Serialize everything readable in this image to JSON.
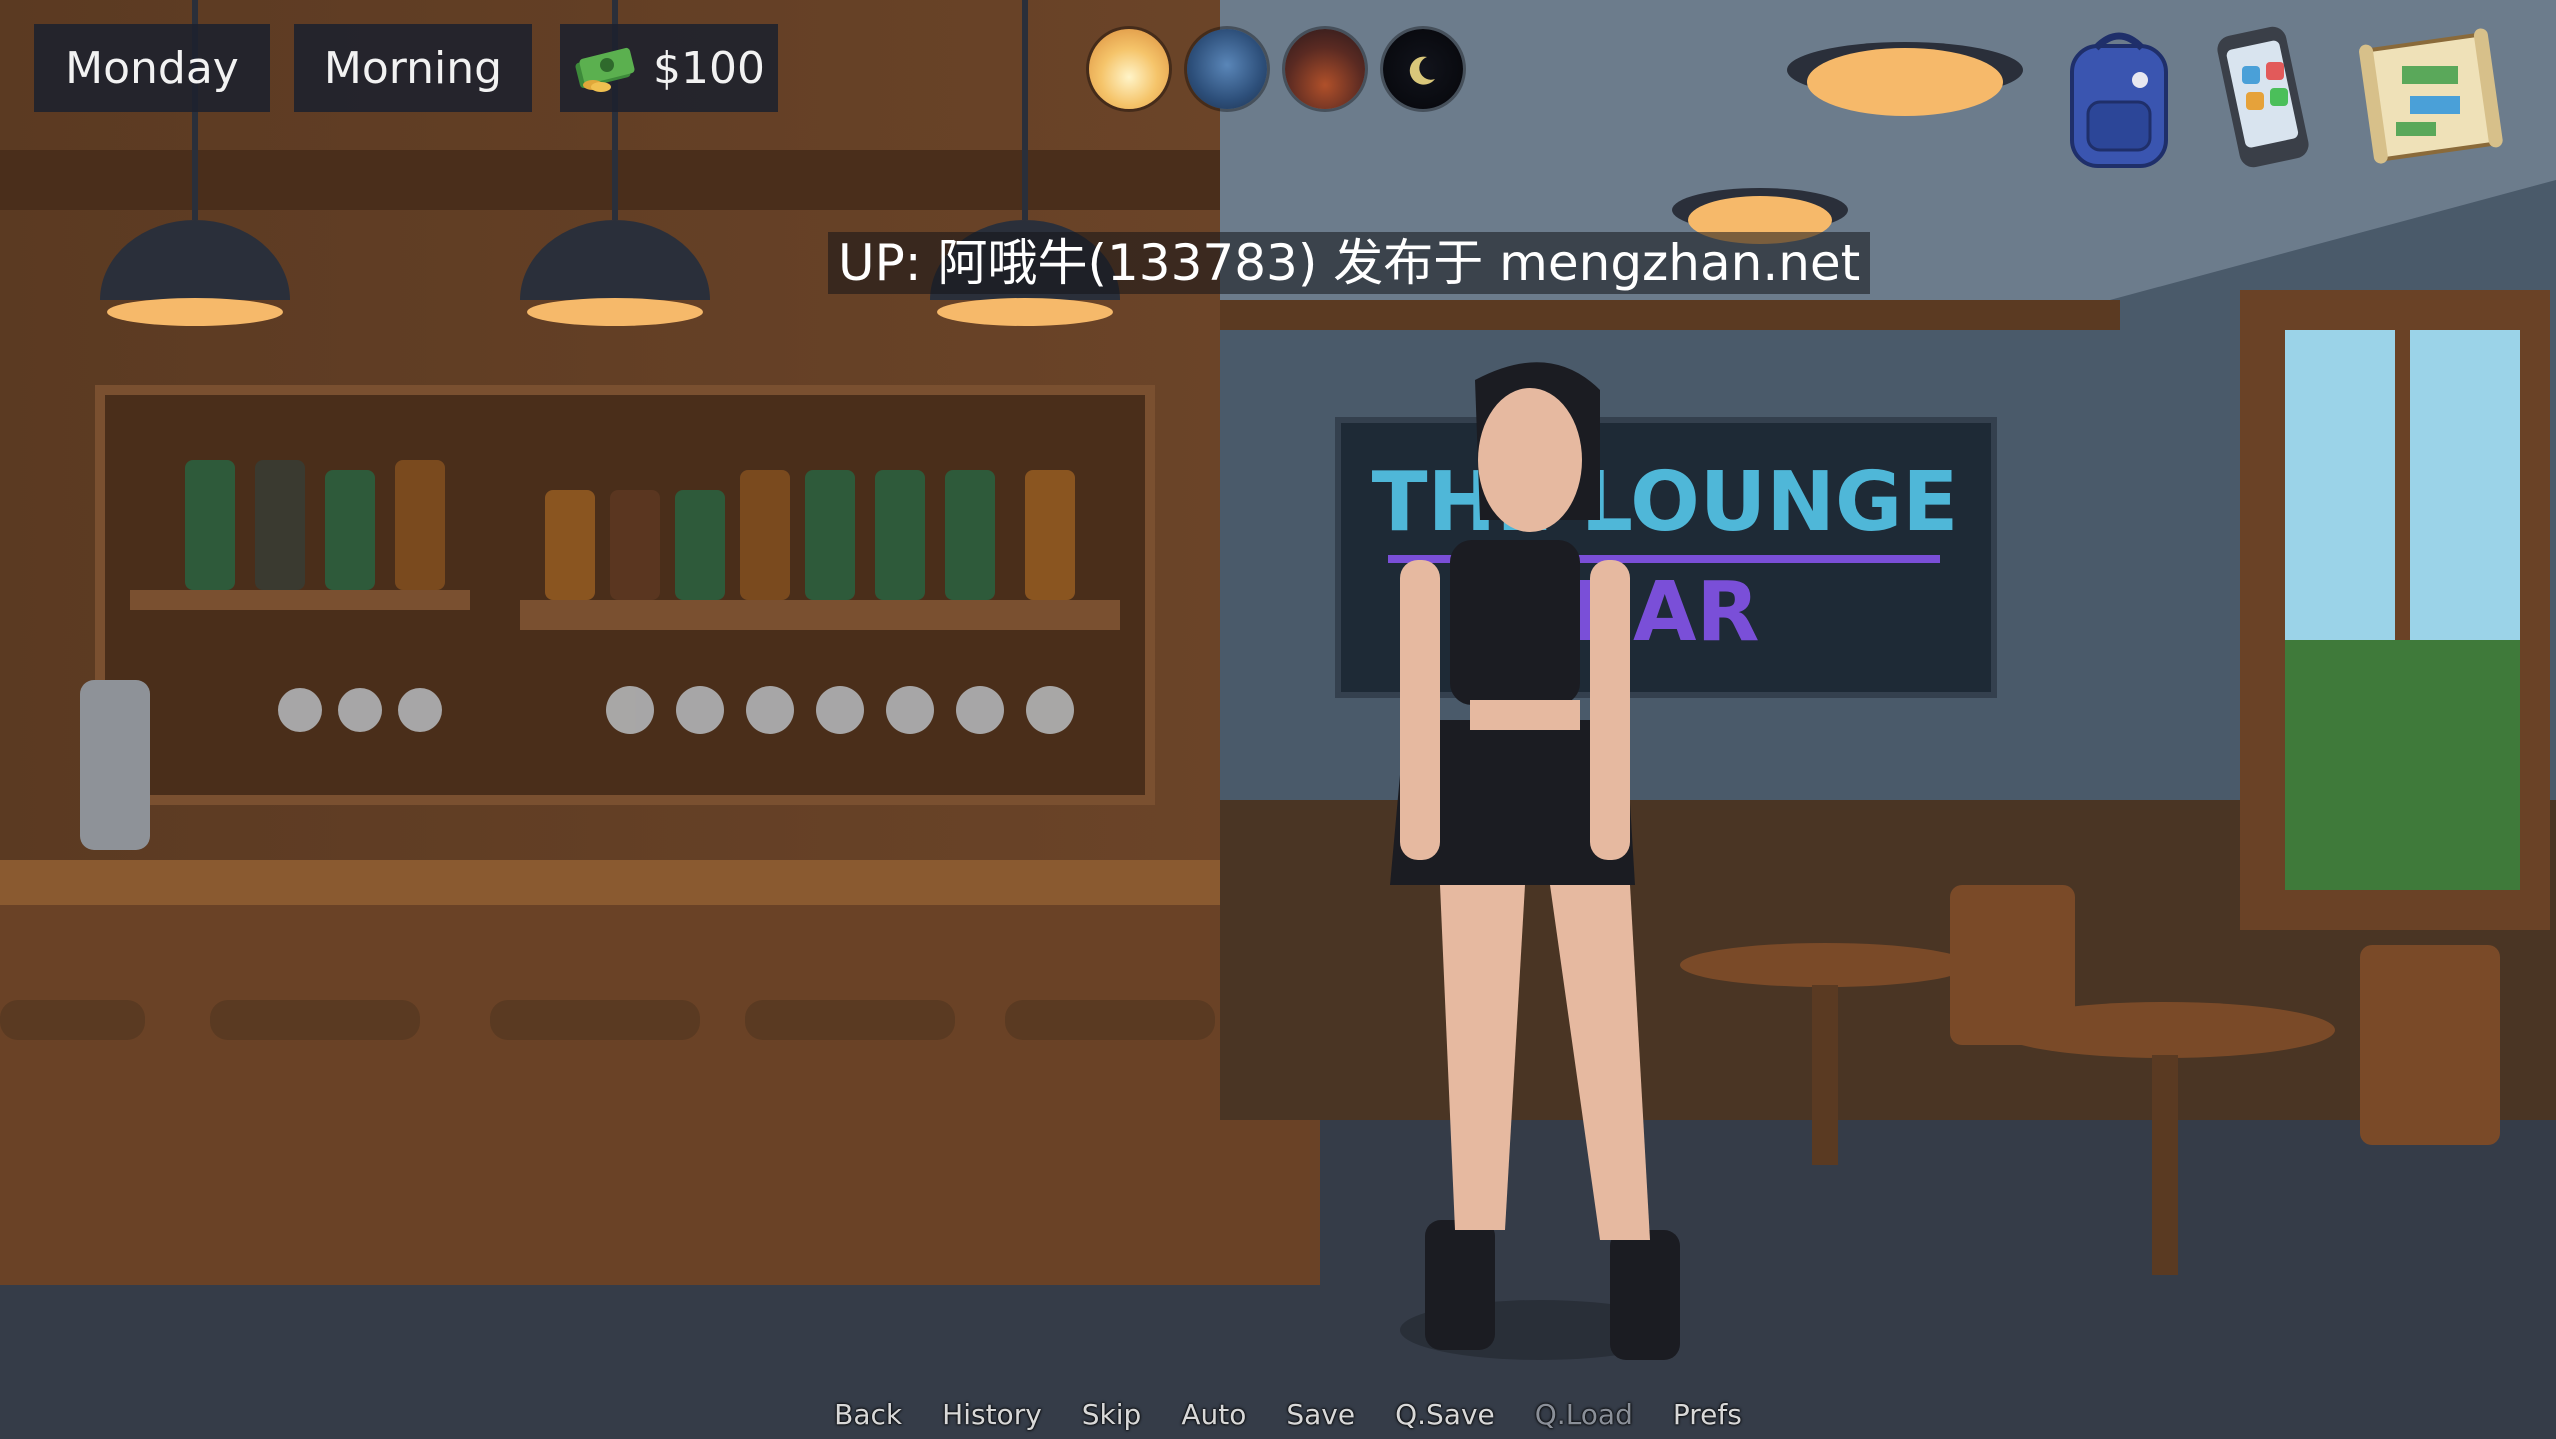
{
  "hud": {
    "day": "Monday",
    "time_of_day": "Morning",
    "money": "$100",
    "money_icon": "cash-stack-icon"
  },
  "time_phases": [
    {
      "name": "morning",
      "icon": "sunrise-icon"
    },
    {
      "name": "afternoon",
      "icon": "planet-day-icon"
    },
    {
      "name": "evening",
      "icon": "sunset-icon"
    },
    {
      "name": "night",
      "icon": "crescent-moon-icon"
    }
  ],
  "top_right_icons": [
    "backpack-icon",
    "phone-icon",
    "map-icon"
  ],
  "watermark": "UP: 阿哦牛(133783) 发布于 mengzhan.net",
  "scene": {
    "sign_line1": "THE LOUNGE",
    "sign_line2": "BAR"
  },
  "quick_menu": {
    "back": "Back",
    "history": "History",
    "skip": "Skip",
    "auto": "Auto",
    "save": "Save",
    "qsave": "Q.Save",
    "qload": "Q.Load",
    "prefs": "Prefs"
  },
  "colors": {
    "sign_text": "#4fb7d8",
    "sign_text_bar": "#7a4fd8",
    "hud_bg": "#1c212d"
  }
}
